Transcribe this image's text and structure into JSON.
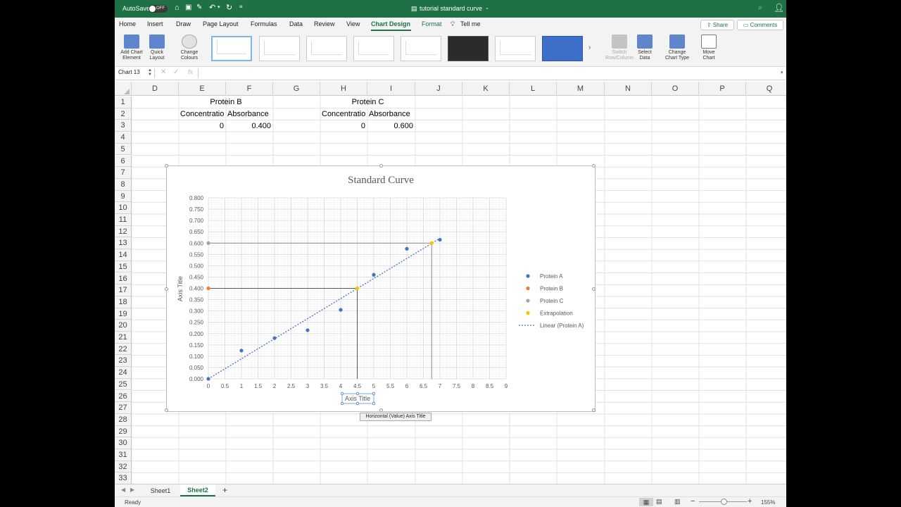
{
  "title_bar": {
    "autosave_label": "AutoSave",
    "autosave_state": "OFF",
    "doc_title": "tutorial standard curve"
  },
  "ribbon_tabs": [
    "Home",
    "Insert",
    "Draw",
    "Page Layout",
    "Formulas",
    "Data",
    "Review",
    "View",
    "Chart Design",
    "Format"
  ],
  "tell_me": "Tell me",
  "share_label": "Share",
  "comments_label": "Comments",
  "ribbon_buttons": {
    "add_chart_element": [
      "Add Chart",
      "Element"
    ],
    "quick_layout": [
      "Quick",
      "Layout"
    ],
    "change_colours": [
      "Change",
      "Colours"
    ],
    "switch_row_column": [
      "Switch",
      "Row/Column"
    ],
    "select_data": [
      "Select",
      "Data"
    ],
    "change_chart_type": [
      "Change",
      "Chart Type"
    ],
    "move_chart": [
      "Move",
      "Chart"
    ]
  },
  "name_box": "Chart 13",
  "fx_label": "fx",
  "columns": [
    "D",
    "E",
    "F",
    "G",
    "H",
    "I",
    "J",
    "K",
    "L",
    "M",
    "N",
    "O",
    "P",
    "Q"
  ],
  "rows": [
    "1",
    "2",
    "3",
    "4",
    "5",
    "6",
    "7",
    "8",
    "9",
    "10",
    "11",
    "12",
    "13",
    "14",
    "15",
    "16",
    "17",
    "18",
    "19",
    "20",
    "21",
    "22",
    "23",
    "24",
    "25",
    "26",
    "27",
    "28",
    "29",
    "30",
    "31",
    "32",
    "33"
  ],
  "cells": {
    "e1": "Protein B",
    "e2": "Concentratio",
    "f2": "Absorbance",
    "e3": "0",
    "f3": "0.400",
    "h1": "Protein C",
    "h2": "Concentratio",
    "i2": "Absorbance",
    "h3": "0",
    "i3": "0.600"
  },
  "chart_data": {
    "type": "scatter",
    "title": "Standard Curve",
    "xlabel": "Axis Title",
    "ylabel": "Axis Title",
    "xlim": [
      0,
      9
    ],
    "ylim": [
      0,
      0.8
    ],
    "x_ticks": [
      "0",
      "0.5",
      "1",
      "1.5",
      "2",
      "2.5",
      "3",
      "3.5",
      "4",
      "4.5",
      "5",
      "5.5",
      "6",
      "6.5",
      "7",
      "7.5",
      "8",
      "8.5",
      "9"
    ],
    "y_ticks": [
      "0.000",
      "0.050",
      "0.100",
      "0.150",
      "0.200",
      "0.250",
      "0.300",
      "0.350",
      "0.400",
      "0.450",
      "0.500",
      "0.550",
      "0.600",
      "0.650",
      "0.700",
      "0.750",
      "0.800"
    ],
    "grid": true,
    "legend_position": "right",
    "series": [
      {
        "name": "Protein A",
        "color": "#4472c4",
        "x": [
          0,
          1,
          2,
          3,
          4,
          5,
          6,
          7
        ],
        "y": [
          0.0,
          0.125,
          0.18,
          0.215,
          0.305,
          0.46,
          0.575,
          0.615
        ]
      },
      {
        "name": "Protein B",
        "color": "#ed7d31",
        "x": [
          0
        ],
        "y": [
          0.4
        ]
      },
      {
        "name": "Protein C",
        "color": "#a5a5a5",
        "x": [
          0
        ],
        "y": [
          0.6
        ]
      },
      {
        "name": "Extrapolation",
        "color": "#ffc000",
        "x": [
          4.5,
          6.75
        ],
        "y": [
          0.4,
          0.6
        ]
      }
    ],
    "trendline": {
      "name": "Linear (Protein A)",
      "color": "#4472c4",
      "x": [
        0,
        7
      ],
      "y": [
        0.0,
        0.621
      ]
    },
    "guide_lines": [
      {
        "color": "#555555",
        "x": [
          0,
          4.5,
          4.5
        ],
        "y": [
          0.4,
          0.4,
          0
        ]
      },
      {
        "color": "#888888",
        "x": [
          0,
          6.75,
          6.75
        ],
        "y": [
          0.6,
          0.6,
          0
        ]
      }
    ]
  },
  "tooltip": "Horizontal (Value) Axis Title",
  "sheets": [
    "Sheet1",
    "Sheet2"
  ],
  "active_sheet": "Sheet2",
  "status_text": "Ready",
  "zoom": "155%"
}
